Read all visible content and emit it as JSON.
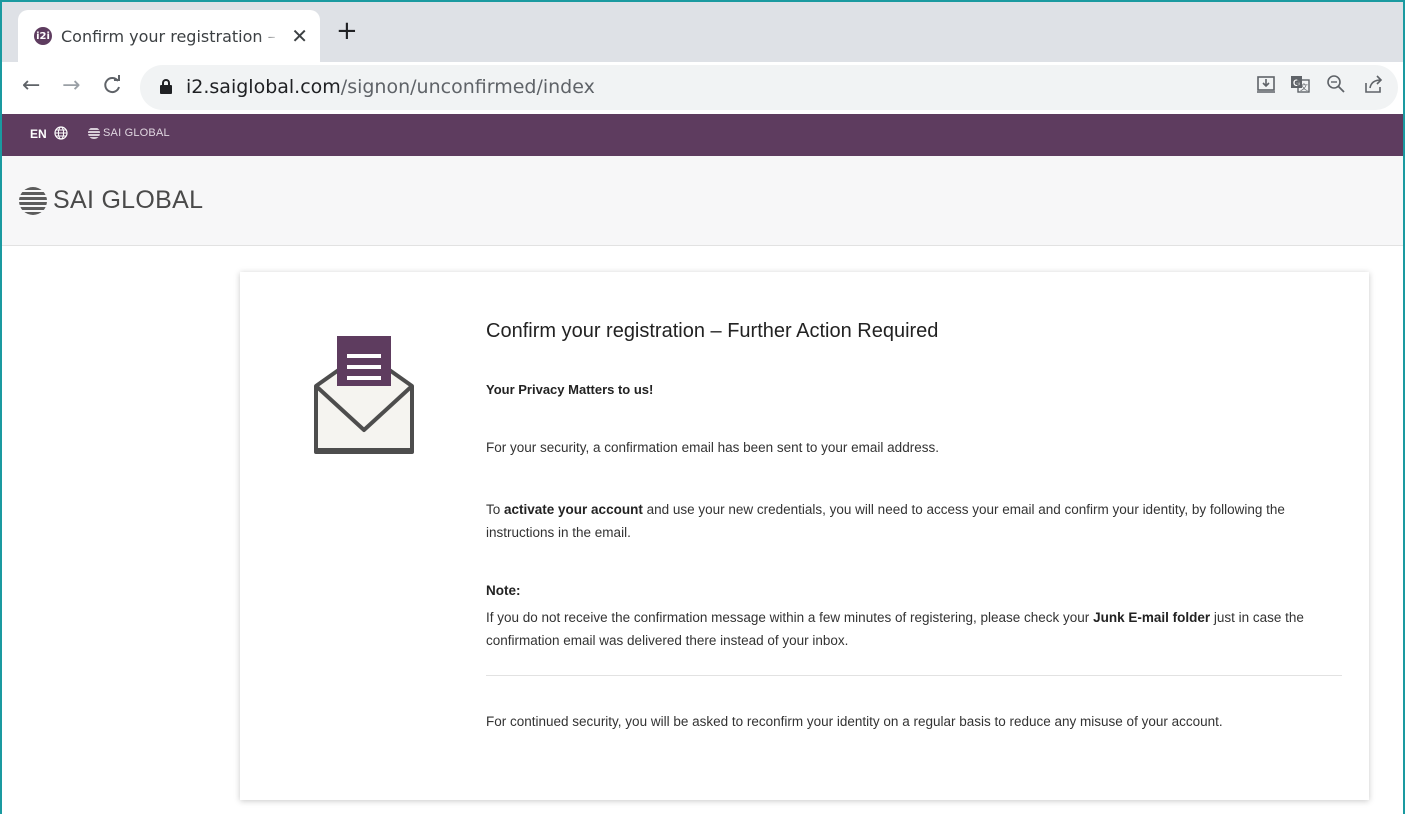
{
  "browser": {
    "tab": {
      "favicon_text": "i2i",
      "title": "Confirm your registration – Furth",
      "close_glyph": "✕"
    },
    "new_tab_glyph": "+",
    "nav": {
      "back": "←",
      "forward": "→",
      "reload": "C"
    },
    "url": {
      "host": "i2.saiglobal.com",
      "path": "/signon/unconfirmed/index"
    },
    "toolbar_icons": [
      "install-app-icon",
      "translate-icon",
      "zoom-icon",
      "share-icon"
    ]
  },
  "topbar": {
    "language": "EN",
    "brand_small": "SAI GLOBAL"
  },
  "header": {
    "brand": "SAI GLOBAL"
  },
  "card": {
    "title": "Confirm your registration – Further Action Required",
    "privacy_heading": "Your Privacy Matters to us!",
    "p1": "For your security, a confirmation email has been sent to your email address.",
    "p2_before": "To ",
    "p2_bold": "activate your account",
    "p2_after": " and use your new credentials, you will need to access your email and confirm your identity, by following the instructions in the email.",
    "note_label": "Note:",
    "p3_before": "If you do not receive the confirmation message within a few minutes of registering, please check your ",
    "p3_bold": "Junk E-mail folder",
    "p3_after": " just in case the confirmation email was delivered there instead of your inbox.",
    "p4": "For continued security, you will be asked to reconfirm your identity on a regular basis to reduce any misuse of your account."
  },
  "colors": {
    "brand_purple": "#5e3c5f",
    "frame_teal": "#1a9aa0",
    "envelope_gray": "#4d4d4d"
  }
}
